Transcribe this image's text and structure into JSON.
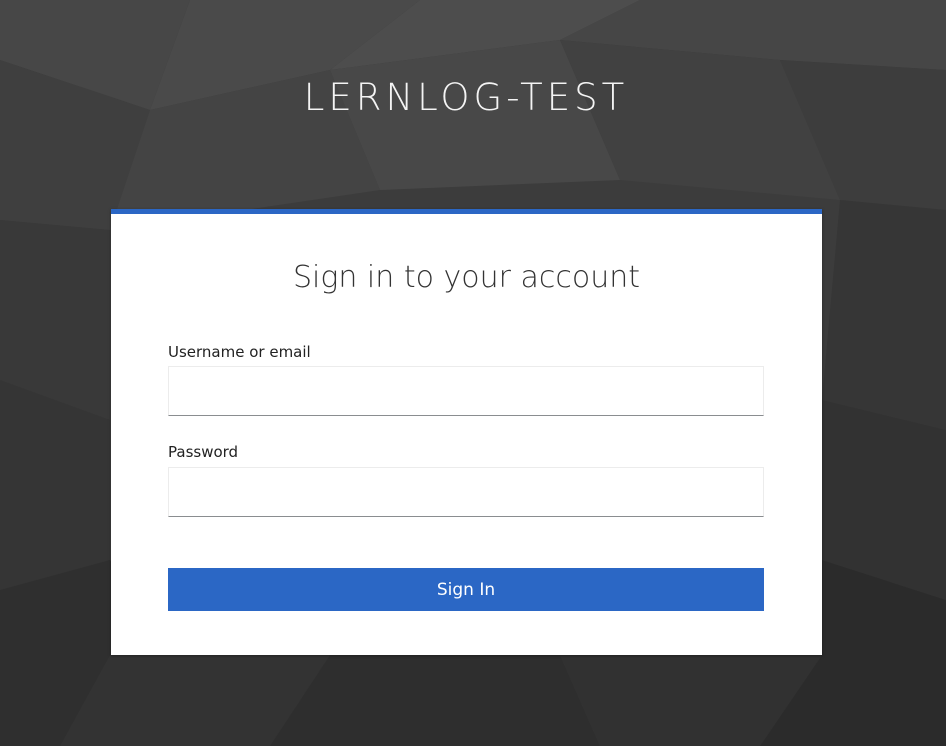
{
  "realm": {
    "title": "LERNLOG-TEST"
  },
  "login_card": {
    "heading": "Sign in to your account",
    "username_label": "Username or email",
    "username_value": "",
    "password_label": "Password",
    "password_value": "",
    "submit_label": "Sign In"
  },
  "colors": {
    "accent": "#2b67c5",
    "background": "#3a3a3a",
    "card": "#ffffff"
  }
}
